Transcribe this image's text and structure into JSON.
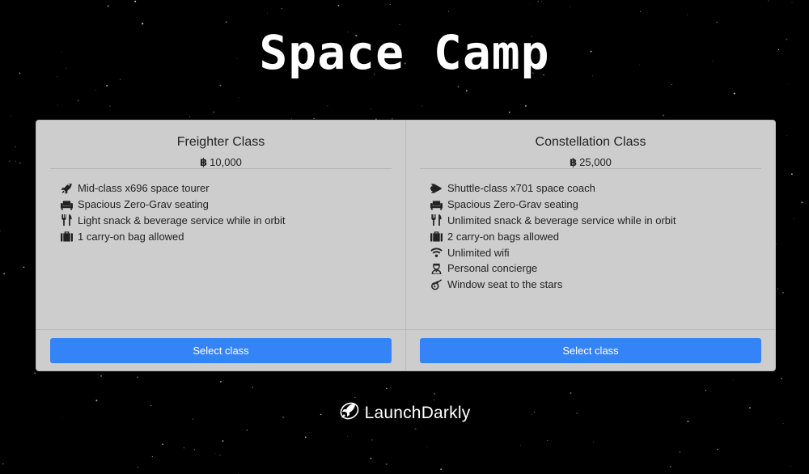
{
  "page": {
    "title": "Space Camp"
  },
  "colors": {
    "background": "#000000",
    "card": "#cdcdcd",
    "button": "#3584f7",
    "button_text": "#ffffff"
  },
  "cards": [
    {
      "title": "Freighter Class",
      "currency_symbol": "฿",
      "price": "10,000",
      "features": [
        {
          "icon": "rocket-icon",
          "text": "Mid-class x696 space tourer"
        },
        {
          "icon": "couch-icon",
          "text": "Spacious Zero-Grav seating"
        },
        {
          "icon": "utensils-icon",
          "text": "Light snack & beverage service while in orbit"
        },
        {
          "icon": "suitcase-icon",
          "text": "1 carry-on bag allowed"
        }
      ],
      "button_label": "Select class"
    },
    {
      "title": "Constellation Class",
      "currency_symbol": "฿",
      "price": "25,000",
      "features": [
        {
          "icon": "space-shuttle-icon",
          "text": "Shuttle-class x701 space coach"
        },
        {
          "icon": "couch-icon",
          "text": "Spacious Zero-Grav seating"
        },
        {
          "icon": "utensils-icon",
          "text": "Unlimited snack & beverage service while in orbit"
        },
        {
          "icon": "suitcase-icon",
          "text": "2 carry-on bags allowed"
        },
        {
          "icon": "wifi-icon",
          "text": "Unlimited wifi"
        },
        {
          "icon": "concierge-icon",
          "text": "Personal concierge"
        },
        {
          "icon": "meteor-icon",
          "text": "Window seat to the stars"
        }
      ],
      "button_label": "Select class"
    }
  ],
  "footer": {
    "brand": "LaunchDarkly",
    "brand_icon": "launchdarkly-logo-icon"
  }
}
